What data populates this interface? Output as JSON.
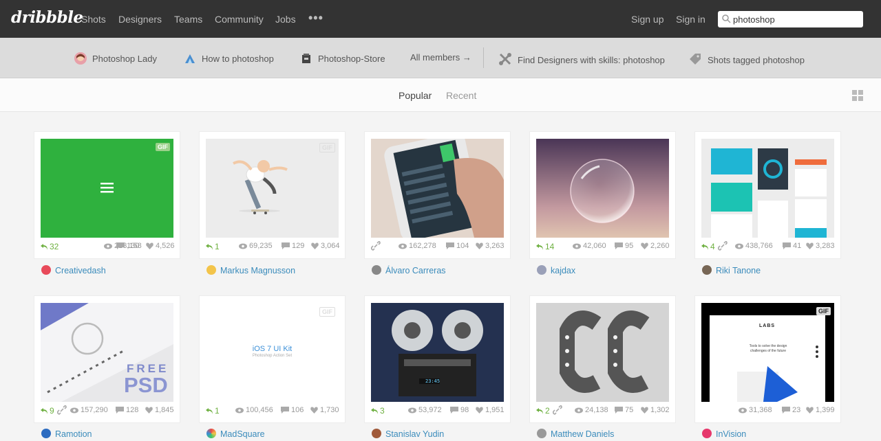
{
  "header": {
    "logo": "dribbble",
    "nav": [
      "Shots",
      "Designers",
      "Teams",
      "Community",
      "Jobs"
    ],
    "more": "•••",
    "signup": "Sign up",
    "signin": "Sign in",
    "search_value": "photoshop"
  },
  "related": {
    "items": [
      "Photoshop Lady",
      "How to photoshop",
      "Photoshop-Store"
    ],
    "all_members": "All members →",
    "find_designers": "Find Designers with skills: photoshop",
    "shots_tagged": "Shots tagged photoshop"
  },
  "tabs": {
    "popular": "Popular",
    "recent": "Recent"
  },
  "shots": [
    {
      "rebounds": "32",
      "views": "213,158",
      "comments": "130",
      "likes": "4,526",
      "player": "Creativedash",
      "gif": "GIF"
    },
    {
      "rebounds": "1",
      "views": "69,235",
      "comments": "129",
      "likes": "3,064",
      "player": "Markus Magnusson",
      "gif": "GIF"
    },
    {
      "rebounds": "",
      "views": "162,278",
      "comments": "104",
      "likes": "3,263",
      "player": "Álvaro Carreras",
      "gif": ""
    },
    {
      "rebounds": "14",
      "views": "42,060",
      "comments": "95",
      "likes": "2,260",
      "player": "kajdax",
      "gif": ""
    },
    {
      "rebounds": "4",
      "views": "438,766",
      "comments": "41",
      "likes": "3,283",
      "player": "Riki Tanone",
      "gif": ""
    },
    {
      "rebounds": "9",
      "views": "157,290",
      "comments": "128",
      "likes": "1,845",
      "player": "Ramotion",
      "gif": ""
    },
    {
      "rebounds": "1",
      "views": "100,456",
      "comments": "106",
      "likes": "1,730",
      "player": "MadSquare",
      "gif": "GIF"
    },
    {
      "rebounds": "3",
      "views": "53,972",
      "comments": "98",
      "likes": "1,951",
      "player": "Stanislav Yudin",
      "gif": ""
    },
    {
      "rebounds": "2",
      "views": "24,138",
      "comments": "75",
      "likes": "1,302",
      "player": "Matthew Daniels",
      "gif": ""
    },
    {
      "rebounds": "",
      "views": "31,368",
      "comments": "23",
      "likes": "1,399",
      "player": "InVision",
      "gif": "GIF"
    }
  ],
  "thumb_text": {
    "psd_free": "FREE",
    "psd_big": "PSD",
    "ios_title": "iOS 7 UI Kit",
    "ios_sub": "Photoshop Action Set",
    "labs_title": "LABS",
    "labs_text": "Tools to solve the design challenges of the future",
    "tape_display": "23:45"
  },
  "colors": {
    "topbar": "#333333",
    "related_bar": "#dcdcdc",
    "link": "#3a8bbb",
    "rebound_green": "#6eb040",
    "creativedash_green": "#2fb13e"
  }
}
